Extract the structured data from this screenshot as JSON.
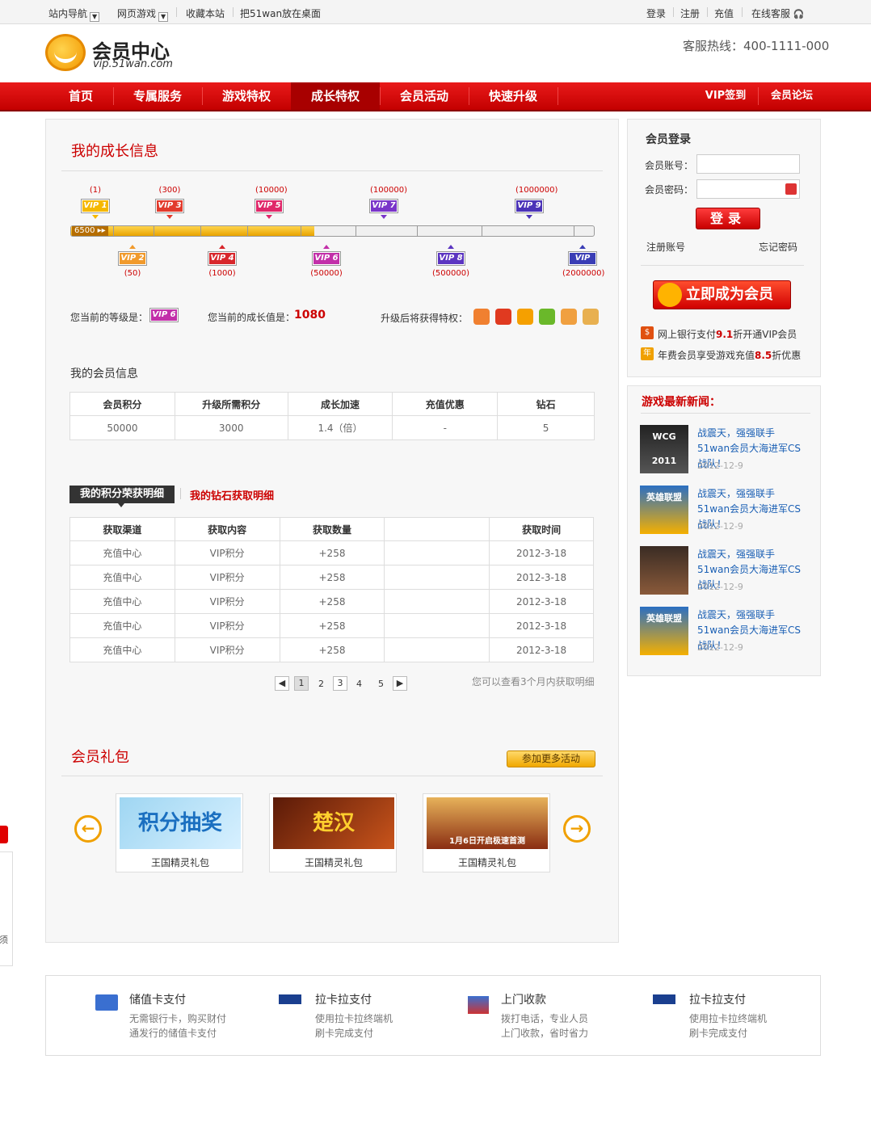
{
  "topbar": {
    "site_nav": "站内导航",
    "web_games": "网页游戏",
    "bookmark": "收藏本站",
    "desktop": "把51wan放在桌面",
    "login": "登录",
    "register": "注册",
    "recharge": "充值",
    "service": "在线客服"
  },
  "header": {
    "title": "会员中心",
    "sub": "vip.51wan.com",
    "hotline": "客服热线：400-1111-000"
  },
  "nav": {
    "items": [
      "首页",
      "专属服务",
      "游戏特权",
      "成长特权",
      "会员活动",
      "快速升级"
    ],
    "active": "成长特权",
    "right": [
      "VIP签到",
      "会员论坛"
    ]
  },
  "growth": {
    "title": "我的成长信息",
    "levels_top": [
      {
        "label": "VIP 1",
        "value": "(1)",
        "color": "#f5b800"
      },
      {
        "label": "VIP 3",
        "value": "(300)",
        "color": "#e23b2d"
      },
      {
        "label": "VIP 5",
        "value": "(10000)",
        "color": "#e0286a"
      },
      {
        "label": "VIP 7",
        "value": "(100000)",
        "color": "#7a35c9"
      },
      {
        "label": "VIP 9",
        "value": "(1000000)",
        "color": "#4b33b8"
      }
    ],
    "levels_bottom": [
      {
        "label": "VIP 2",
        "value": "(50)",
        "color": "#f19a2c"
      },
      {
        "label": "VIP 4",
        "value": "(1000)",
        "color": "#d8262b"
      },
      {
        "label": "VIP 6",
        "value": "(50000)",
        "color": "#c22fa9"
      },
      {
        "label": "VIP 8",
        "value": "(500000)",
        "color": "#5b35c1"
      },
      {
        "label": "VIP 10",
        "value": "(2000000)",
        "color": "#3a3db5"
      }
    ],
    "bar_value": "6500",
    "current_level_label": "您当前的等级是：",
    "current_level": "VIP 6",
    "current_growth_label": "您当前的成长值是：",
    "current_growth": "1080",
    "privilege_label": "升级后将获得特权："
  },
  "member_info": {
    "title": "我的会员信息",
    "headers": [
      "会员积分",
      "升级所需积分",
      "成长加速",
      "充值优惠",
      "钻石"
    ],
    "row": [
      "50000",
      "3000",
      "1.4（倍）",
      "-",
      "5"
    ]
  },
  "records": {
    "tab_points": "我的积分荣获明细",
    "tab_diamond": "我的钻石获取明细",
    "headers": [
      "获取渠道",
      "获取内容",
      "获取数量",
      "",
      "获取时间"
    ],
    "rows": [
      [
        "充值中心",
        "VIP积分",
        "+258",
        "",
        "2012-3-18"
      ],
      [
        "充值中心",
        "VIP积分",
        "+258",
        "",
        "2012-3-18"
      ],
      [
        "充值中心",
        "VIP积分",
        "+258",
        "",
        "2012-3-18"
      ],
      [
        "充值中心",
        "VIP积分",
        "+258",
        "",
        "2012-3-18"
      ],
      [
        "充值中心",
        "VIP积分",
        "+258",
        "",
        "2012-3-18"
      ]
    ],
    "pages": [
      "1",
      "2",
      "3",
      "4",
      "5"
    ],
    "note": "您可以查看3个月内获取明细"
  },
  "gifts": {
    "title": "会员礼包",
    "more": "参加更多活动",
    "items": [
      {
        "label": "王国精灵礼包",
        "banner": "积分抽奖"
      },
      {
        "label": "王国精灵礼包",
        "banner": "楚汉"
      },
      {
        "label": "王国精灵礼包",
        "banner": "1月6日开启极速首测"
      }
    ]
  },
  "login": {
    "title": "会员登录",
    "account_label": "会员账号：",
    "password_label": "会员密码：",
    "button": "登录",
    "register": "注册账号",
    "forgot": "忘记密码",
    "join": "立即成为会员",
    "promo1_pre": "网上银行支付",
    "promo1_num": "9.1",
    "promo1_post": "折开通VIP会员",
    "promo2_pre": "年费会员享受游戏充值",
    "promo2_num": "8.5",
    "promo2_post": "折优惠"
  },
  "news": {
    "title": "游戏最新新闻：",
    "items": [
      {
        "title": "战震天，强强联手51wan会员大海进军CS战队！",
        "date": "2012-12-9",
        "img_text": "WCG 2011"
      },
      {
        "title": "战震天，强强联手51wan会员大海进军CS战队！",
        "date": "2012-12-9",
        "img_text": "英雄联盟"
      },
      {
        "title": "战震天，强强联手51wan会员大海进军CS战队！",
        "date": "2012-12-9",
        "img_text": ""
      },
      {
        "title": "战震天，强强联手51wan会员大海进军CS战队！",
        "date": "2012-12-9",
        "img_text": "英雄联盟"
      }
    ]
  },
  "footer": [
    {
      "title": "储值卡支付",
      "desc1": "无需银行卡，购买财付",
      "desc2": "通发行的储值卡支付"
    },
    {
      "title": "拉卡拉支付",
      "desc1": "使用拉卡拉终端机",
      "desc2": "刷卡完成支付"
    },
    {
      "title": "上门收款",
      "desc1": "拨打电话，专业人员",
      "desc2": "上门收款，省时省力"
    },
    {
      "title": "拉卡拉支付",
      "desc1": "使用拉卡拉终端机",
      "desc2": "刷卡完成支付"
    }
  ],
  "sidebar": {
    "tab_text": "须"
  }
}
